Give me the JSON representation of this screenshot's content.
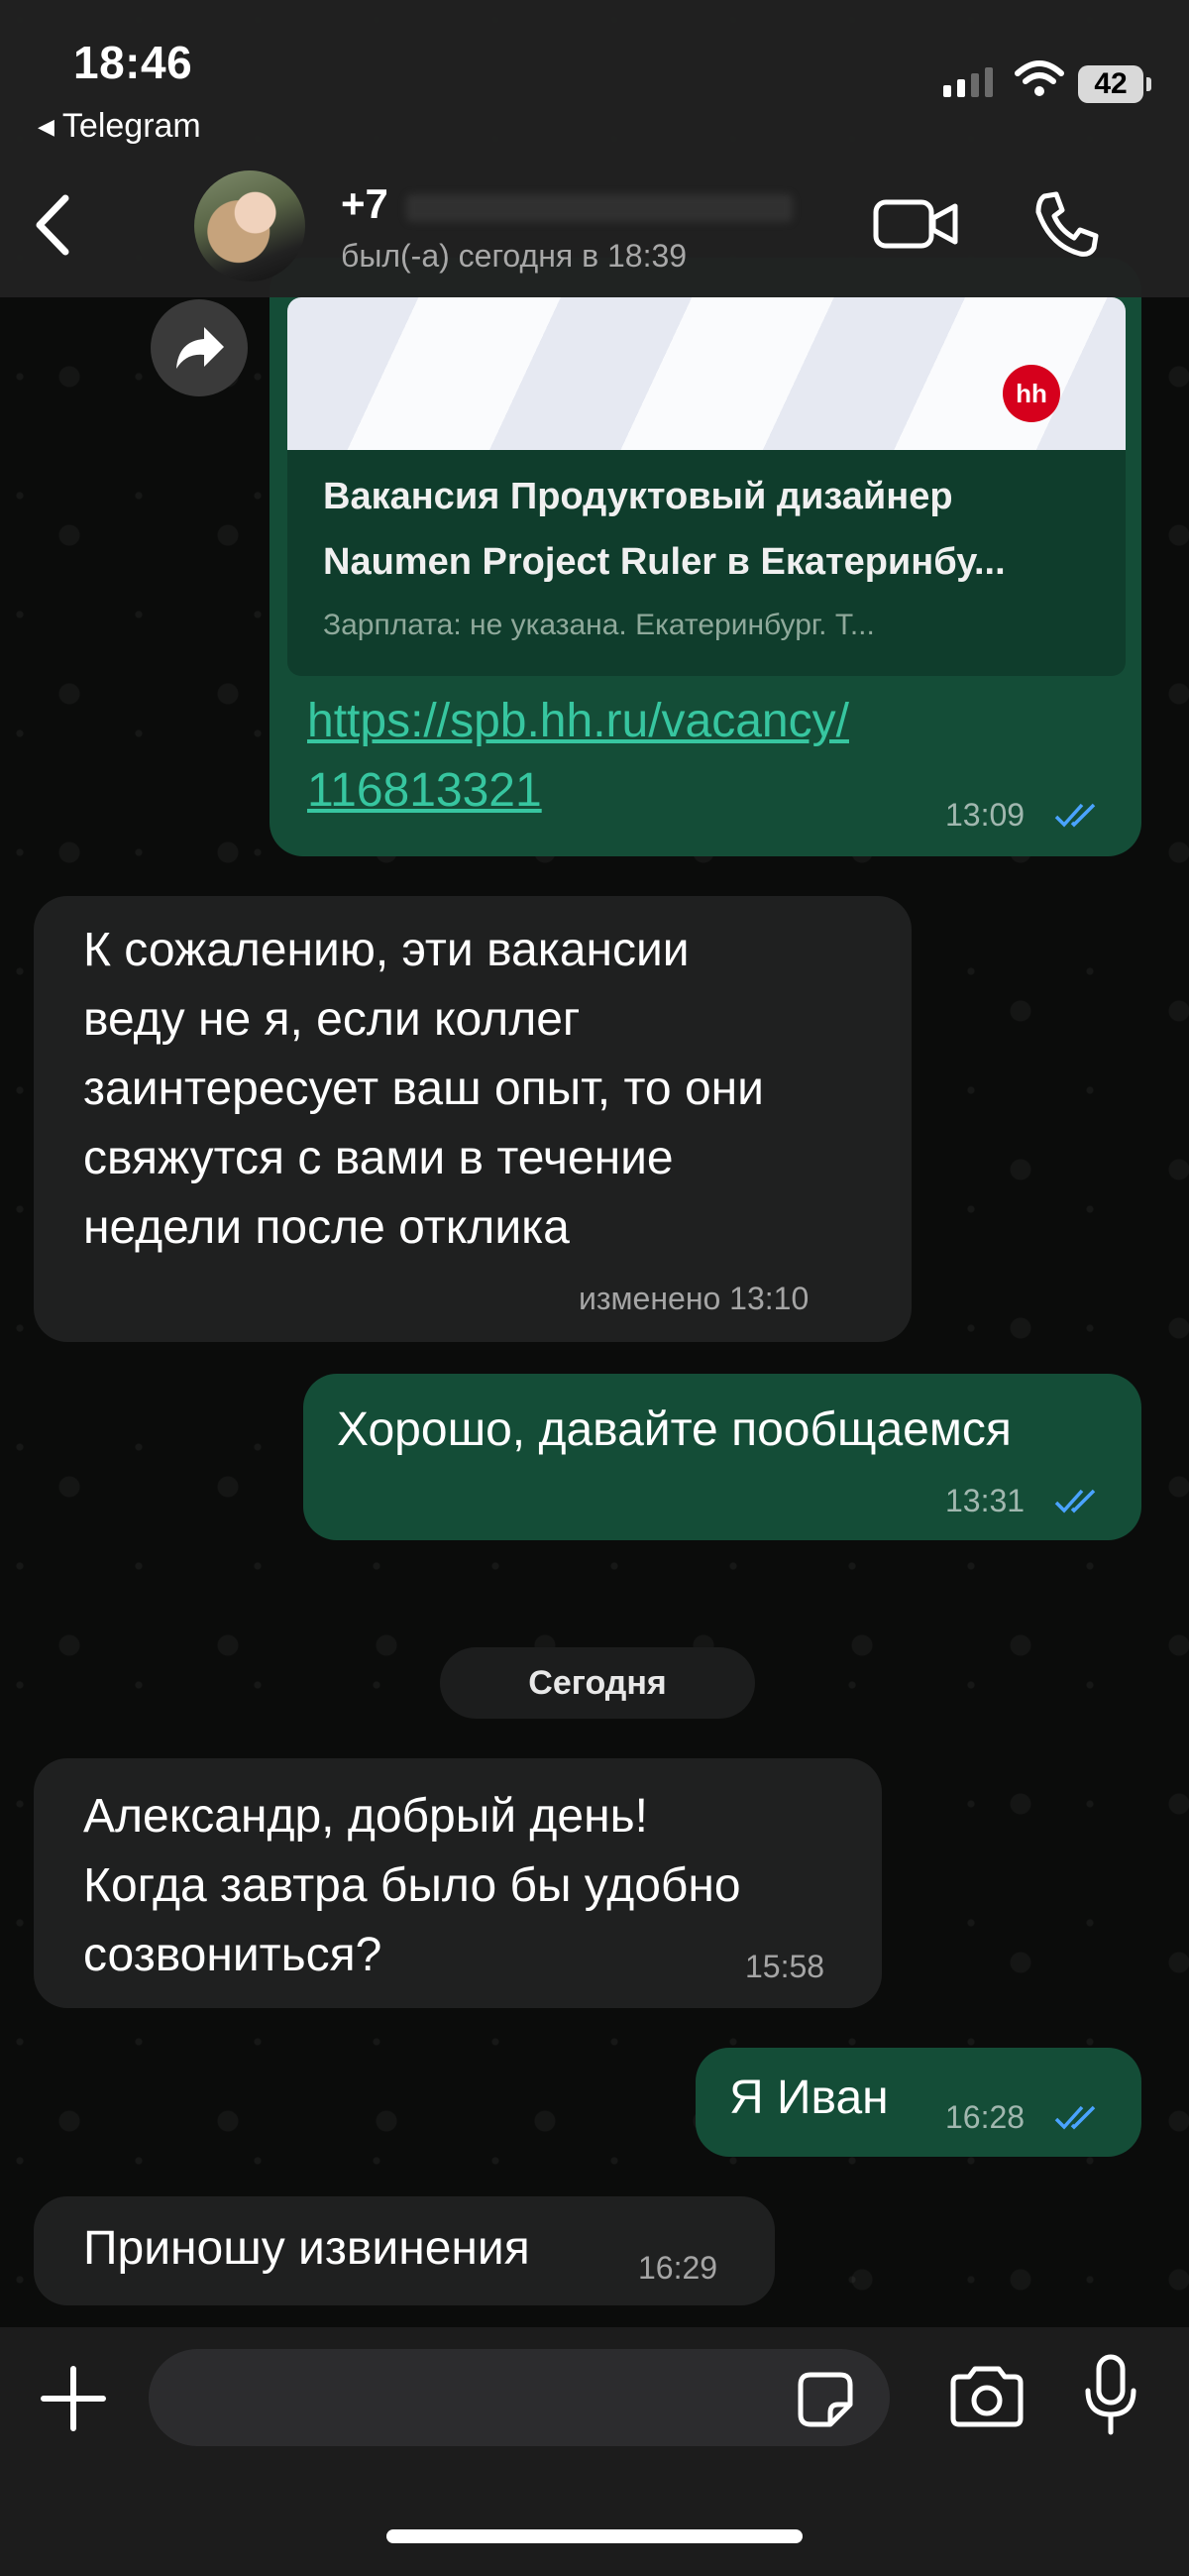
{
  "status_bar": {
    "time": "18:46",
    "back_app": "Telegram",
    "battery": "42"
  },
  "header": {
    "contact_name": "+7",
    "contact_status": "был(-а) сегодня в 18:39"
  },
  "messages": {
    "m1": {
      "preview_site": "hh",
      "preview_title_line1": "Вакансия Продуктовый дизайнер",
      "preview_title_line2": "Naumen Project Ruler в Екатеринбу...",
      "preview_desc": "Зарплата: не указана. Екатеринбург. Т...",
      "link_line1": "https://spb.hh.ru/vacancy/",
      "link_line2": "116813321",
      "time": "13:09"
    },
    "m2": {
      "lines": [
        "К сожалению, эти вакансии",
        "веду не я, если коллег",
        "заинтересует ваш опыт, то они",
        "свяжутся с вами в течение",
        "недели после отклика"
      ],
      "time": "изменено 13:10"
    },
    "m3": {
      "text": "Хорошо, давайте пообщаемся",
      "time": "13:31"
    },
    "date_separator": "Сегодня",
    "m4": {
      "lines": [
        "Александр, добрый день!",
        "Когда завтра было бы удобно",
        "созвониться?"
      ],
      "time": "15:58"
    },
    "m5": {
      "text": "Я Иван",
      "time": "16:28"
    },
    "m6": {
      "text": "Приношу извинения",
      "time": "16:29"
    }
  },
  "colors": {
    "outgoing_bubble": "#144d37",
    "incoming_bubble": "#1f2020",
    "link": "#37c6a0",
    "read_ticks": "#4aa3ff"
  },
  "icons": [
    "back-chevron-icon",
    "video-call-icon",
    "phone-icon",
    "forward-icon",
    "plus-icon",
    "sticker-icon",
    "camera-icon",
    "microphone-icon"
  ]
}
